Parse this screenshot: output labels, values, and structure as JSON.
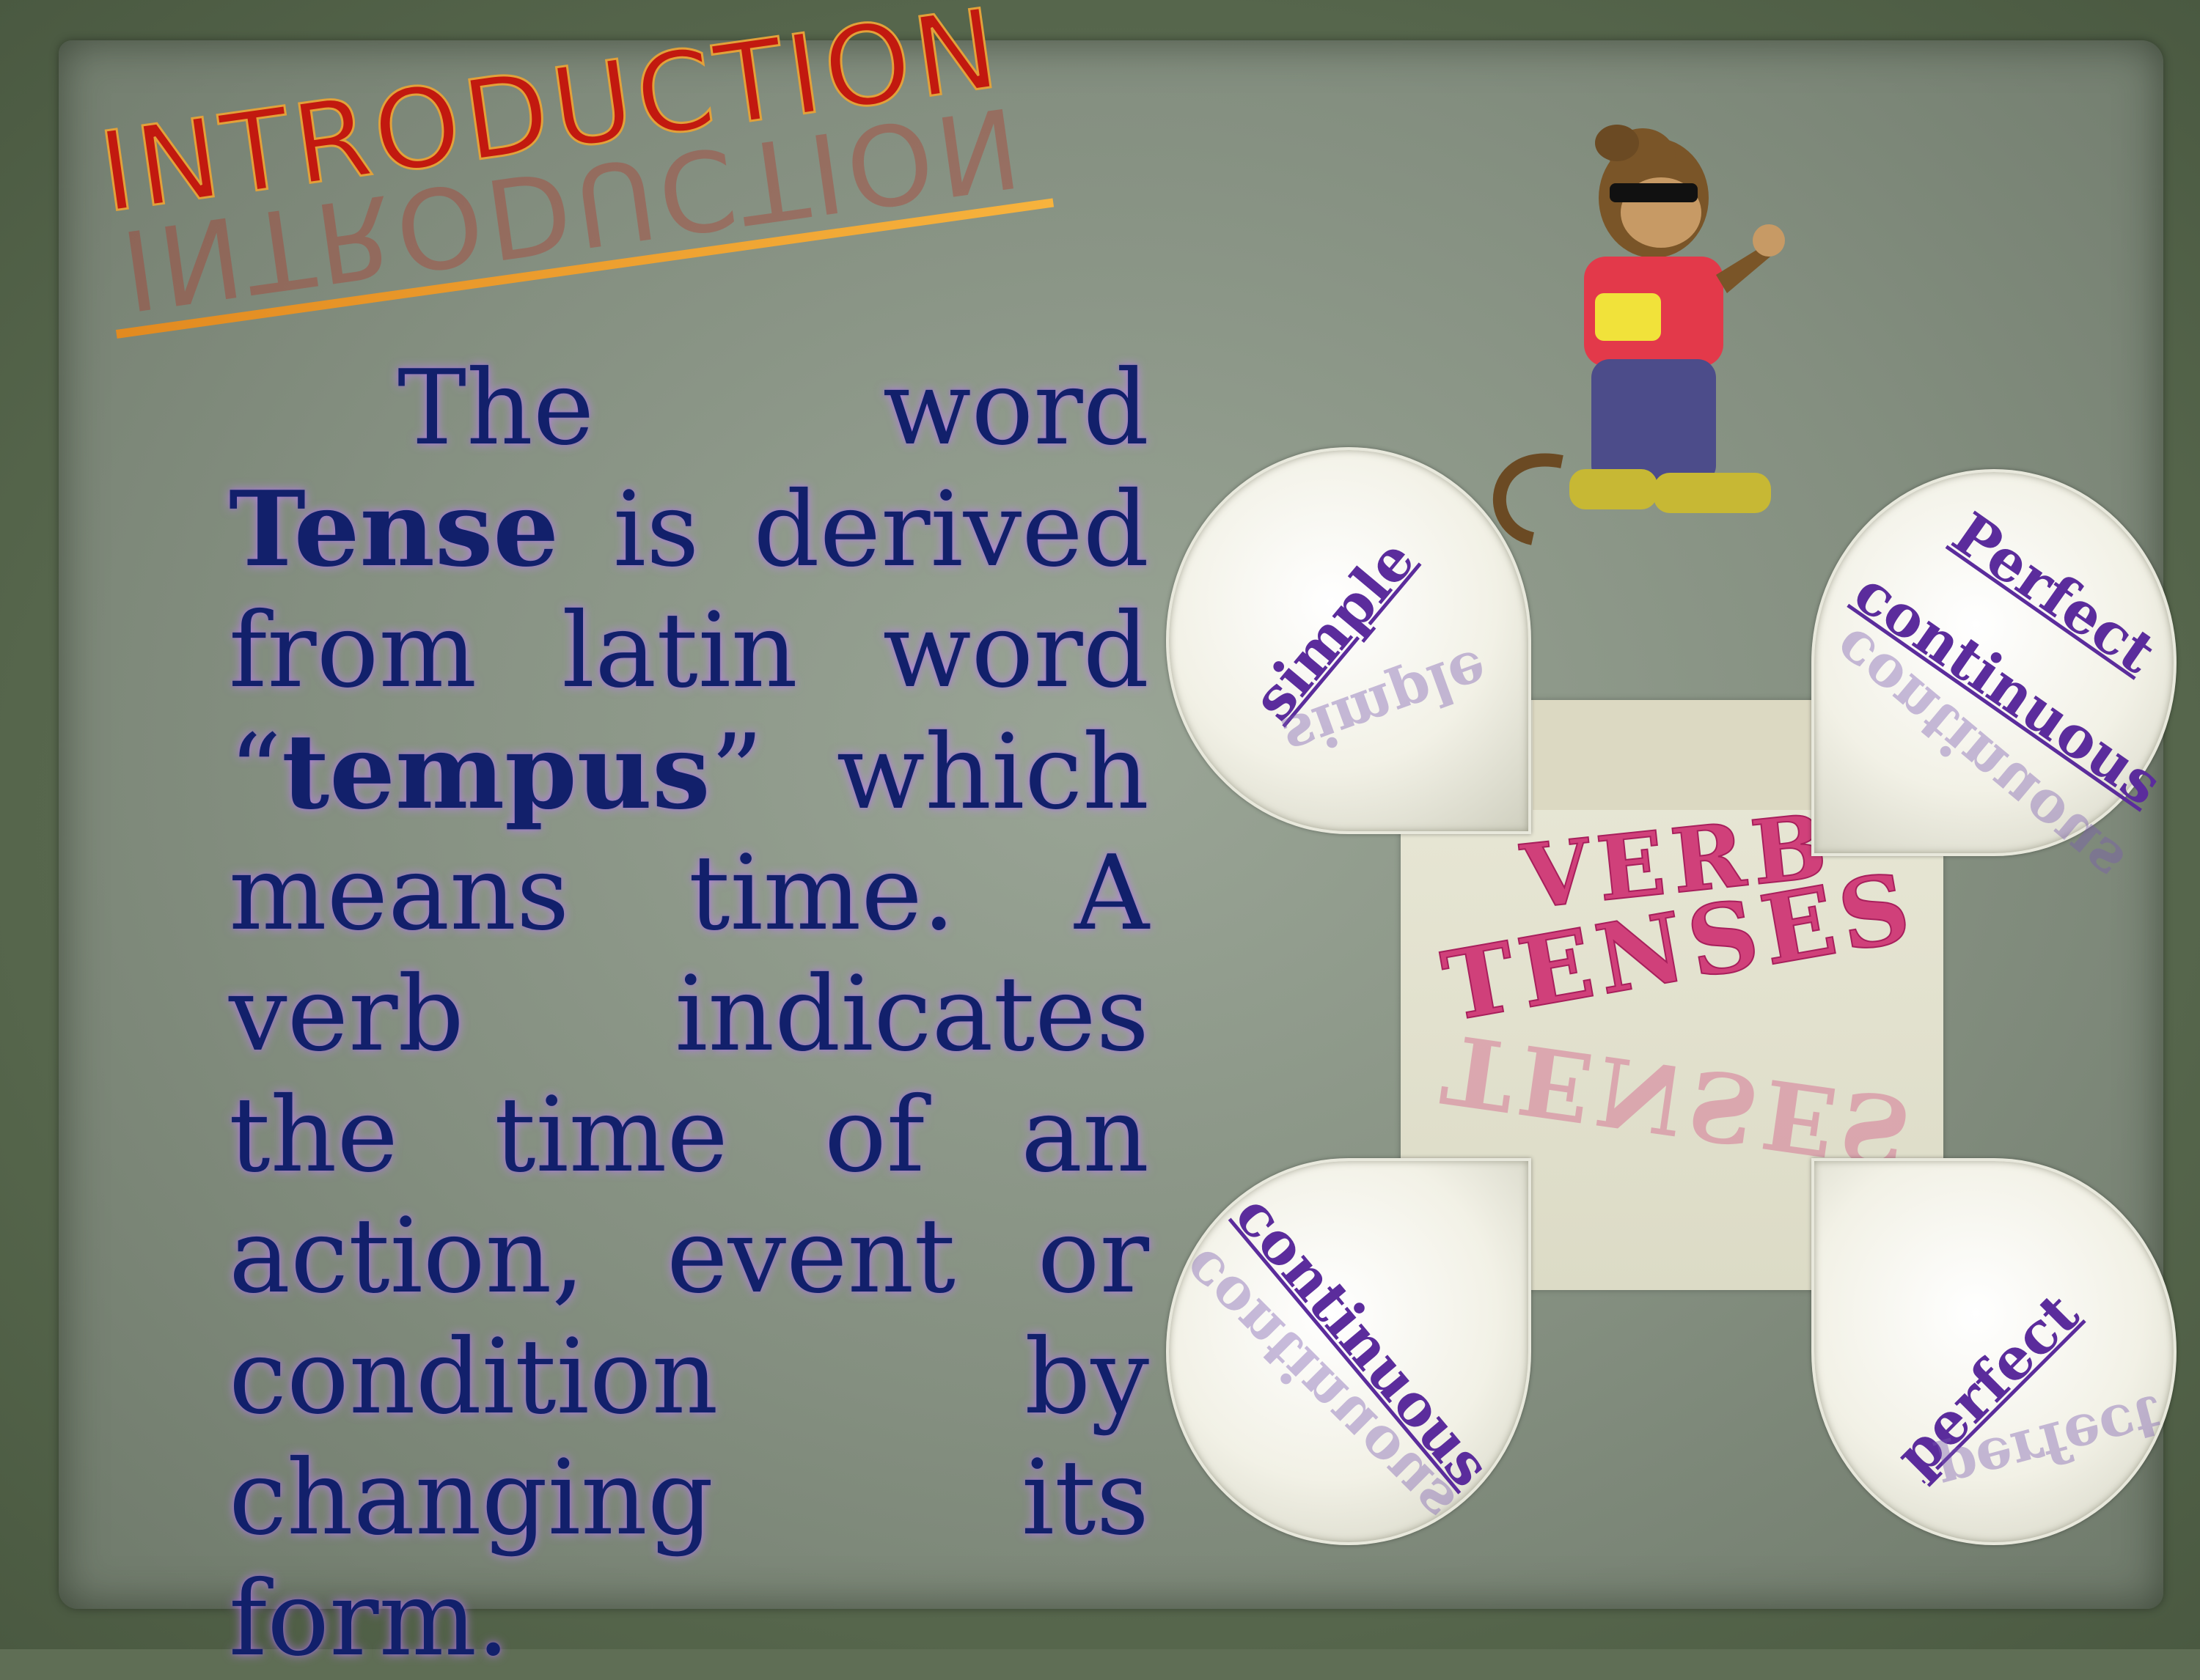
{
  "slide": {
    "title": "INTRODUCTION",
    "body": {
      "intro": "The word",
      "term": "Tense",
      "after_term": "is derived from latin word “",
      "origin": "tempus",
      "rest": "” which means time. A verb indicates the time of an action, event or condition by changing its form."
    }
  },
  "diagram": {
    "center_line1": "VERB",
    "center_line2": "TENSES",
    "petals": {
      "top_left": "simple",
      "top_right_1": "Perfect",
      "top_right_2": "continuous",
      "bottom_left": "continuous",
      "bottom_right": "perfect"
    }
  },
  "colors": {
    "title": "#c2190f",
    "body_text": "#12206b",
    "petal_text": "#5b2c9c",
    "center_text": "#d0407a"
  }
}
